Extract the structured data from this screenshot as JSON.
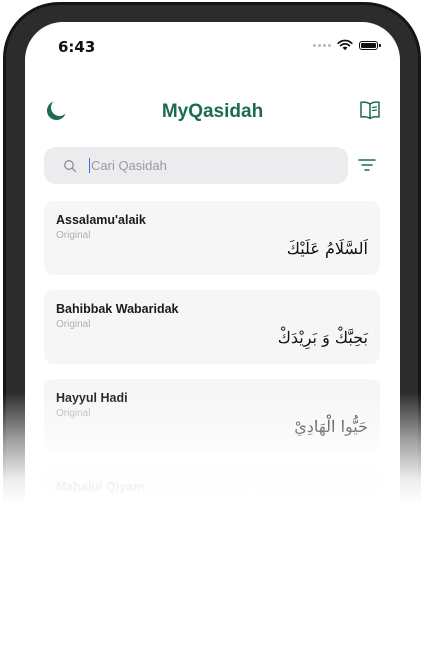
{
  "status_bar": {
    "time": "6:43"
  },
  "header": {
    "title": "MyQasidah",
    "left_icon": "moon-icon",
    "right_icon": "book-icon"
  },
  "search": {
    "placeholder": "Cari Qasidah",
    "value": ""
  },
  "filter": {
    "icon": "filter-icon"
  },
  "colors": {
    "brand": "#1c6b53",
    "card_bg": "#f6f6f7",
    "search_bg": "#ececee",
    "cursor": "#3b6ef5"
  },
  "qasidah_list": [
    {
      "title": "Assalamu'alaik",
      "subtitle": "Original",
      "arabic": "اَلسَّلَامُ عَلَيْكَ"
    },
    {
      "title": "Bahibbak Wabaridak",
      "subtitle": "Original",
      "arabic": "بَحِبَّكْ وَ بَرِيْدَكْ"
    },
    {
      "title": "Hayyul Hadi",
      "subtitle": "Original",
      "arabic": "حَيُّوا الْهَادِيْ"
    },
    {
      "title": "Mahalul Qiyam",
      "subtitle": "",
      "arabic": ""
    }
  ]
}
